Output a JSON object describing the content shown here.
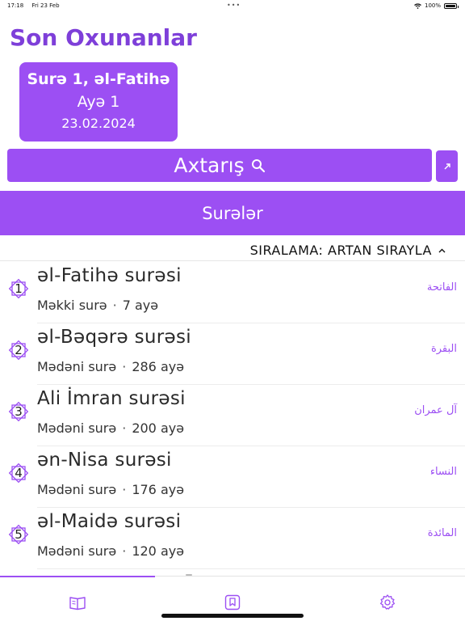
{
  "status_bar": {
    "time": "17:18",
    "date": "Fri 23 Feb",
    "battery": "100%",
    "battery_level": 1.0
  },
  "header": {
    "title": "Son Oxunanlar"
  },
  "recent": {
    "sura": "Surə 1, əl-Fatihə",
    "aya": "Ayə 1",
    "date": "23.02.2024"
  },
  "search": {
    "label": "Axtarış",
    "icon": "search-icon"
  },
  "section": {
    "title": "Surələr"
  },
  "sort": {
    "label": "SIRALAMA: ARTAN SIRAYLA"
  },
  "suras": [
    {
      "number": "1",
      "name": "əl-Fatihə surəsi",
      "type": "Məkki surə",
      "ayahs": "7 ayə",
      "arabic": "الفاتحة"
    },
    {
      "number": "2",
      "name": "əl-Bəqərə surəsi",
      "type": "Mədəni surə",
      "ayahs": "286 ayə",
      "arabic": "البقرة"
    },
    {
      "number": "3",
      "name": "Ali İmran surəsi",
      "type": "Mədəni surə",
      "ayahs": "200 ayə",
      "arabic": "آل عمران"
    },
    {
      "number": "4",
      "name": "ən-Nisa surəsi",
      "type": "Mədəni surə",
      "ayahs": "176 ayə",
      "arabic": "النساء"
    },
    {
      "number": "5",
      "name": "əl-Maidə surəsi",
      "type": "Mədəni surə",
      "ayahs": "120 ayə",
      "arabic": "المائدة"
    }
  ],
  "tabs": [
    {
      "icon": "book-icon",
      "selected": true
    },
    {
      "icon": "bookmark-icon",
      "selected": false
    },
    {
      "icon": "gear-icon",
      "selected": false
    }
  ],
  "colors": {
    "accent": "#9c4ff3",
    "title": "#7e3fd9",
    "arabic": "#9c4ff3"
  }
}
